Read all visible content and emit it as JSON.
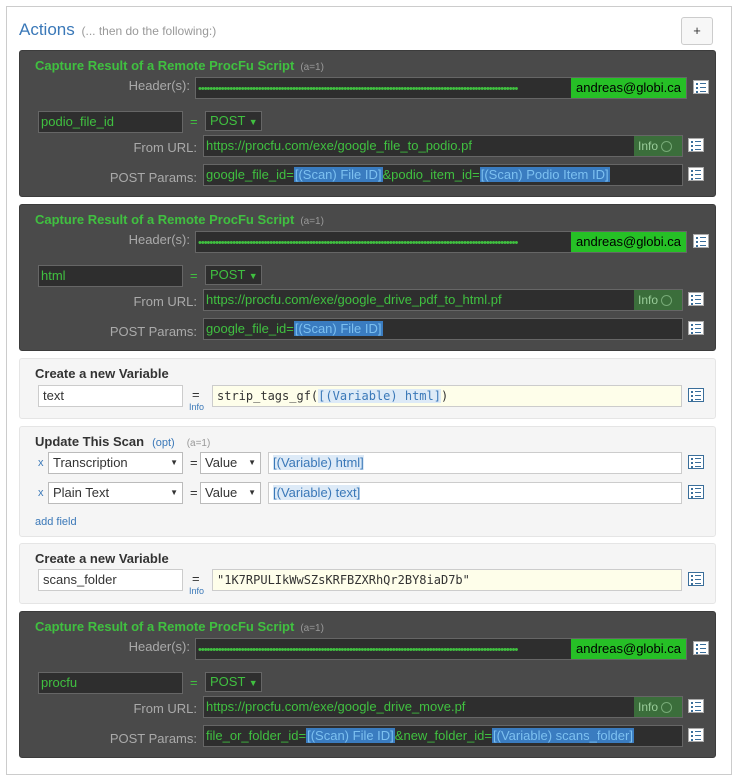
{
  "actions": {
    "title": "Actions",
    "subtitle": "(... then do the following:)",
    "add_label": "+"
  },
  "panel1": {
    "title": "Capture Result of a Remote ProcFu Script",
    "meta": "(a=1)",
    "header_label": "Header(s):",
    "header_dots": "••••••••••••••••••••••••••••••••••••••••••••••••••••••••••••••••••••••••••••••••••••••••••••••••••••••••••••••••",
    "header_email": "andreas@globi.ca",
    "var_name": "podio_file_id",
    "eq": "=",
    "method": "POST",
    "url_label": "From URL:",
    "url": "https://procfu.com/exe/google_file_to_podio.pf",
    "info": "Info",
    "params_label": "POST Params:",
    "p1": "google_file_id=",
    "t1": "[(Scan) File ID]",
    "p2": "&podio_item_id=",
    "t2": "[(Scan) Podio Item ID]"
  },
  "panel2": {
    "title": "Capture Result of a Remote ProcFu Script",
    "meta": "(a=1)",
    "header_label": "Header(s):",
    "header_dots": "••••••••••••••••••••••••••••••••••••••••••••••••••••••••••••••••••••••••••••••••••••••••••••••••••••••••••••••••",
    "header_email": "andreas@globi.ca",
    "var_name": "html",
    "eq": "=",
    "method": "POST",
    "url_label": "From URL:",
    "url": "https://procfu.com/exe/google_drive_pdf_to_html.pf",
    "info": "Info",
    "params_label": "POST Params:",
    "p1": "google_file_id=",
    "t1": "[(Scan) File ID]"
  },
  "panel3": {
    "title": "Create a new Variable",
    "var_name": "text",
    "eq": "=",
    "code_pre": "strip_tags_gf(",
    "code_tok": "[(Variable) html]",
    "code_post": ")",
    "info": "Info"
  },
  "panel4": {
    "title": "Update This Scan",
    "opt": "(opt)",
    "meta": "(a=1)",
    "rows": [
      {
        "x": "x",
        "field": "Transcription",
        "eq": "=",
        "mode": "Value",
        "value": "[(Variable) html]"
      },
      {
        "x": "x",
        "field": "Plain Text",
        "eq": "=",
        "mode": "Value",
        "value": "[(Variable) text]"
      }
    ],
    "add_field": "add field"
  },
  "panel5": {
    "title": "Create a new Variable",
    "var_name": "scans_folder",
    "eq": "=",
    "code": "\"1K7RPULIkWwSZsKRFBZXRhQr2BY8iaD7b\"",
    "info": "Info"
  },
  "panel6": {
    "title": "Capture Result of a Remote ProcFu Script",
    "meta": "(a=1)",
    "header_label": "Header(s):",
    "header_dots": "••••••••••••••••••••••••••••••••••••••••••••••••••••••••••••••••••••••••••••••••••••••••••••••••••••••••••••••••",
    "header_email": "andreas@globi.ca",
    "var_name": "procfu",
    "eq": "=",
    "method": "POST",
    "url_label": "From URL:",
    "url": "https://procfu.com/exe/google_drive_move.pf",
    "info": "Info",
    "params_label": "POST Params:",
    "p1": "file_or_folder_id=",
    "t1": "[(Scan) File ID]",
    "p2": "&new_folder_id=",
    "t2": "[(Variable) scans_folder]"
  }
}
